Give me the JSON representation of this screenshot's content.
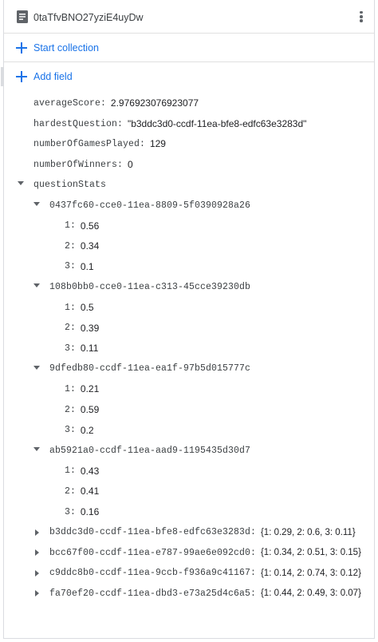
{
  "document": {
    "title": "0taTfvBNO27yziE4uyDw",
    "start_collection_label": "Start collection",
    "add_field_label": "Add field"
  },
  "fields": {
    "averageScore": {
      "key": "averageScore",
      "value": "2.976923076923077"
    },
    "hardestQuestion": {
      "key": "hardestQuestion",
      "value": "\"b3ddc3d0-ccdf-11ea-bfe8-edfc63e3283d\""
    },
    "numberOfGamesPlayed": {
      "key": "numberOfGamesPlayed",
      "value": "129"
    },
    "numberOfWinners": {
      "key": "numberOfWinners",
      "value": "0"
    },
    "questionStats": {
      "key": "questionStats",
      "expanded_maps": [
        {
          "key": "0437fc60-cce0-11ea-8809-5f0390928a26",
          "entries": [
            {
              "key": "1",
              "value": "0.56"
            },
            {
              "key": "2",
              "value": "0.34"
            },
            {
              "key": "3",
              "value": "0.1"
            }
          ]
        },
        {
          "key": "108b0bb0-cce0-11ea-c313-45cce39230db",
          "entries": [
            {
              "key": "1",
              "value": "0.5"
            },
            {
              "key": "2",
              "value": "0.39"
            },
            {
              "key": "3",
              "value": "0.11"
            }
          ]
        },
        {
          "key": "9dfedb80-ccdf-11ea-ea1f-97b5d015777c",
          "entries": [
            {
              "key": "1",
              "value": "0.21"
            },
            {
              "key": "2",
              "value": "0.59"
            },
            {
              "key": "3",
              "value": "0.2"
            }
          ]
        },
        {
          "key": "ab5921a0-ccdf-11ea-aad9-1195435d30d7",
          "entries": [
            {
              "key": "1",
              "value": "0.43"
            },
            {
              "key": "2",
              "value": "0.41"
            },
            {
              "key": "3",
              "value": "0.16"
            }
          ]
        }
      ],
      "collapsed_maps": [
        {
          "key": "b3ddc3d0-ccdf-11ea-bfe8-edfc63e3283d",
          "summary": "{1: 0.29, 2: 0.6, 3: 0.11}"
        },
        {
          "key": "bcc67f00-ccdf-11ea-e787-99ae6e092cd0",
          "summary": "{1: 0.34, 2: 0.51, 3: 0.15}"
        },
        {
          "key": "c9ddc8b0-ccdf-11ea-9ccb-f936a9c41167",
          "summary": "{1: 0.14, 2: 0.74, 3: 0.12}"
        },
        {
          "key": "fa70ef20-ccdf-11ea-dbd3-e73a25d4c6a5",
          "summary": "{1: 0.44, 2: 0.49, 3: 0.07}"
        }
      ]
    }
  },
  "colors": {
    "accent": "#1a73e8",
    "text": "#202124",
    "muted": "#5f6368",
    "border": "#dadce0"
  },
  "icons": {
    "document": "document-icon",
    "more": "more-vert-icon",
    "add": "plus-icon",
    "expand": "arrow-down-icon",
    "collapse": "arrow-right-icon"
  }
}
